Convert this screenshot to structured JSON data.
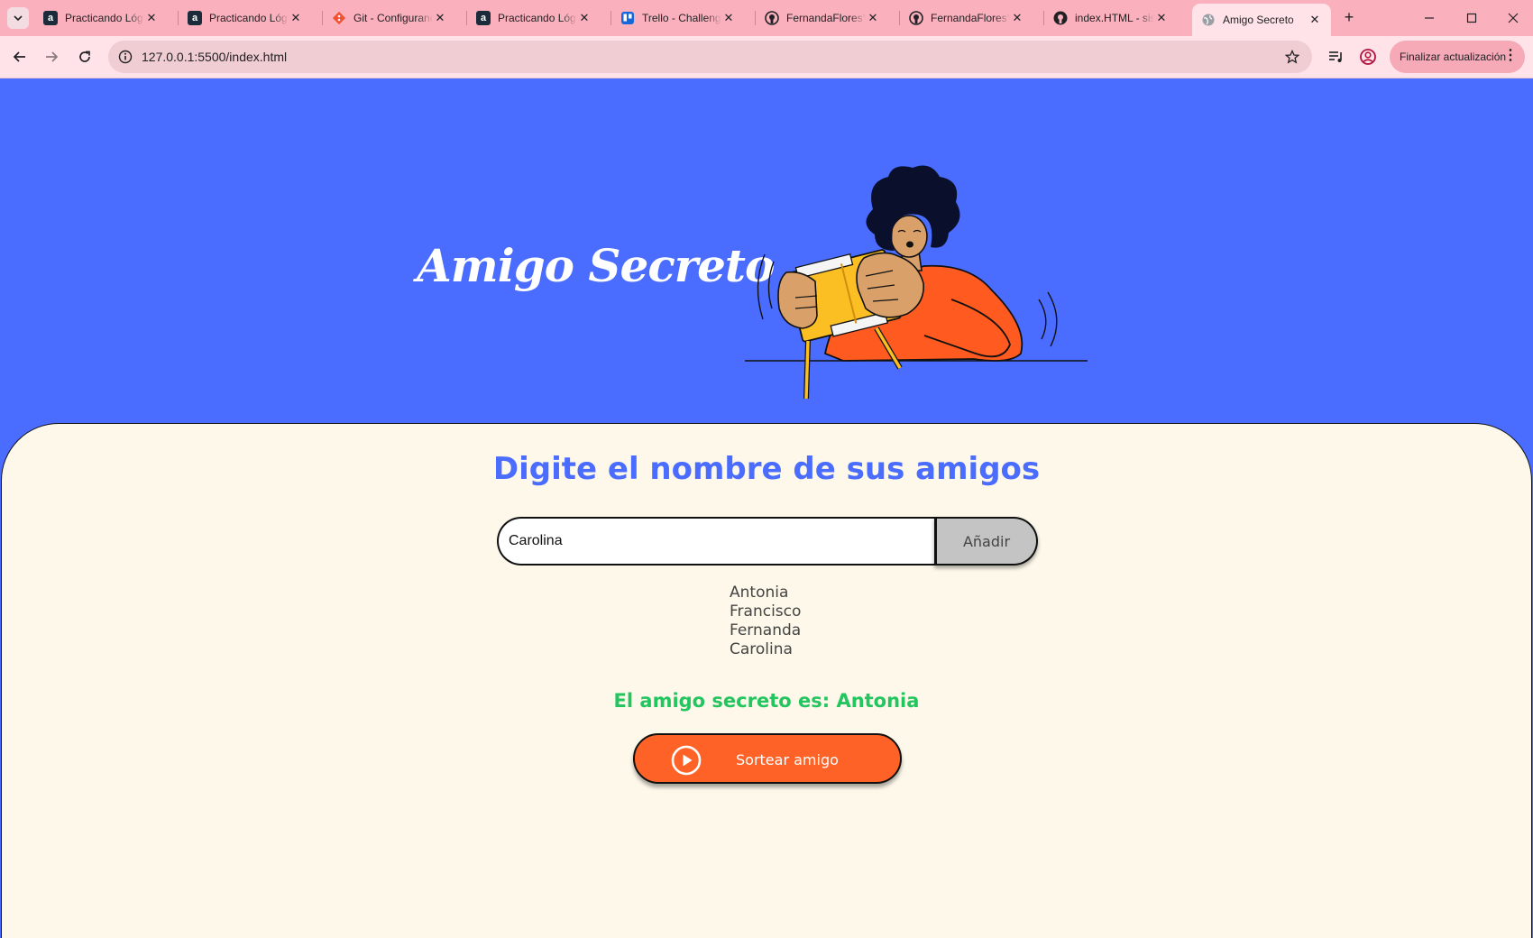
{
  "browser": {
    "tabs": [
      {
        "title": "Practicando Lógica",
        "favicon": "alura-icon"
      },
      {
        "title": "Practicando Lógica",
        "favicon": "alura-icon"
      },
      {
        "title": "Git - Configurando",
        "favicon": "git-icon"
      },
      {
        "title": "Practicando Lógica",
        "favicon": "alura-icon"
      },
      {
        "title": "Trello - Challenge",
        "favicon": "trello-icon"
      },
      {
        "title": "FernandaFloresV",
        "favicon": "github-icon"
      },
      {
        "title": "FernandaFloresV",
        "favicon": "github-icon"
      },
      {
        "title": "index.HTML - sistema",
        "favicon": "github-icon"
      },
      {
        "title": "Amigo Secreto",
        "favicon": "globe-icon",
        "active": true
      }
    ],
    "url": "127.0.0.1:5500/index.html",
    "update_label": "Finalizar actualización"
  },
  "page": {
    "hero_title": "Amigo Secreto",
    "section_title": "Digite el nombre de sus amigos",
    "input_value": "Carolina",
    "add_button": "Añadir",
    "friends": [
      "Antonia",
      "Francisco",
      "Fernanda",
      "Carolina"
    ],
    "result": "El amigo secreto es: Antonia",
    "draw_button": "Sortear amigo"
  },
  "colors": {
    "hero_bg": "#4a6cff",
    "panel_bg": "#fdf8ea",
    "title": "#4a6cff",
    "result": "#22c55e",
    "draw_button": "#ff6227",
    "add_button": "#c4c4c4"
  }
}
